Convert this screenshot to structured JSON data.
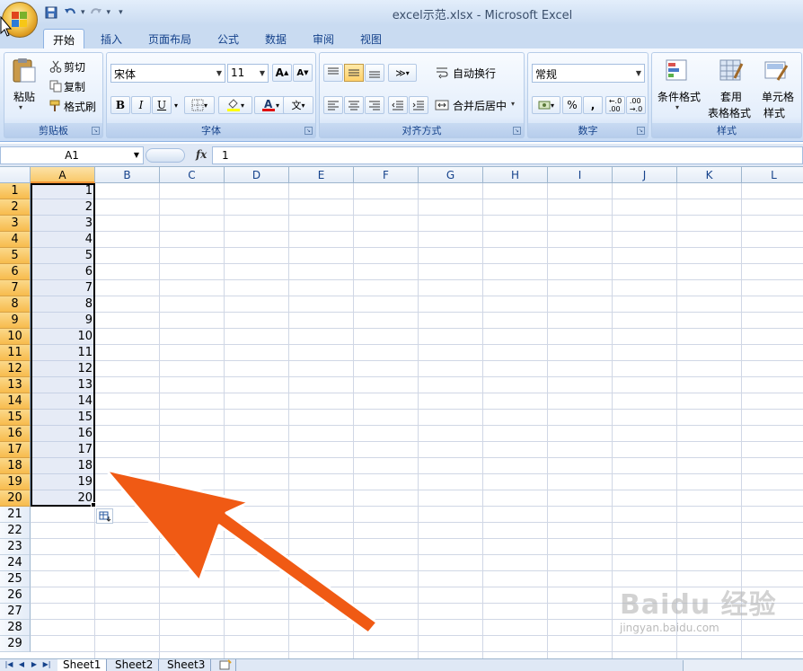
{
  "window": {
    "title": "excel示范.xlsx - Microsoft Excel"
  },
  "quick_access": {
    "save_icon": "save-icon",
    "undo_icon": "undo-icon",
    "redo_icon": "redo-icon",
    "customize_icon": "customize-icon"
  },
  "tabs": [
    {
      "label": "开始",
      "active": true
    },
    {
      "label": "插入"
    },
    {
      "label": "页面布局"
    },
    {
      "label": "公式"
    },
    {
      "label": "数据"
    },
    {
      "label": "审阅"
    },
    {
      "label": "视图"
    }
  ],
  "ribbon": {
    "clipboard": {
      "label": "剪贴板",
      "paste": "粘贴",
      "cut": "剪切",
      "copy": "复制",
      "format_painter": "格式刷"
    },
    "font": {
      "label": "字体",
      "font_name": "宋体",
      "font_size": "11",
      "bold": "B",
      "italic": "I",
      "underline": "U"
    },
    "alignment": {
      "label": "对齐方式",
      "wrap_text": "自动换行",
      "merge_center": "合并后居中"
    },
    "number": {
      "label": "数字",
      "format": "常规",
      "percent": "%",
      "comma": ","
    },
    "styles": {
      "label": "样式",
      "conditional_format": "条件格式",
      "table_format_1": "套用",
      "table_format_2": "表格格式",
      "cell_styles_1": "单元格",
      "cell_styles_2": "样式"
    }
  },
  "formula_bar": {
    "name_box": "A1",
    "fx": "fx",
    "value": "1"
  },
  "columns": [
    "A",
    "B",
    "C",
    "D",
    "E",
    "F",
    "G",
    "H",
    "I",
    "J",
    "K",
    "L"
  ],
  "rows": [
    "1",
    "2",
    "3",
    "4",
    "5",
    "6",
    "7",
    "8",
    "9",
    "10",
    "11",
    "12",
    "13",
    "14",
    "15",
    "16",
    "17",
    "18",
    "19",
    "20",
    "21",
    "22",
    "23",
    "24",
    "25",
    "26",
    "27",
    "28",
    "29"
  ],
  "column_a_values": [
    "1",
    "2",
    "3",
    "4",
    "5",
    "6",
    "7",
    "8",
    "9",
    "10",
    "11",
    "12",
    "13",
    "14",
    "15",
    "16",
    "17",
    "18",
    "19",
    "20"
  ],
  "selection": {
    "range": "A1:A20"
  },
  "sheets": [
    {
      "label": "Sheet1",
      "active": true
    },
    {
      "label": "Sheet2"
    },
    {
      "label": "Sheet3"
    }
  ],
  "watermark": {
    "brand": "Baidu 经验",
    "url": "jingyan.baidu.com"
  },
  "colors": {
    "arrow": "#f05a14",
    "selection_header": "#f9c96a",
    "ribbon_blue": "#15428b"
  }
}
